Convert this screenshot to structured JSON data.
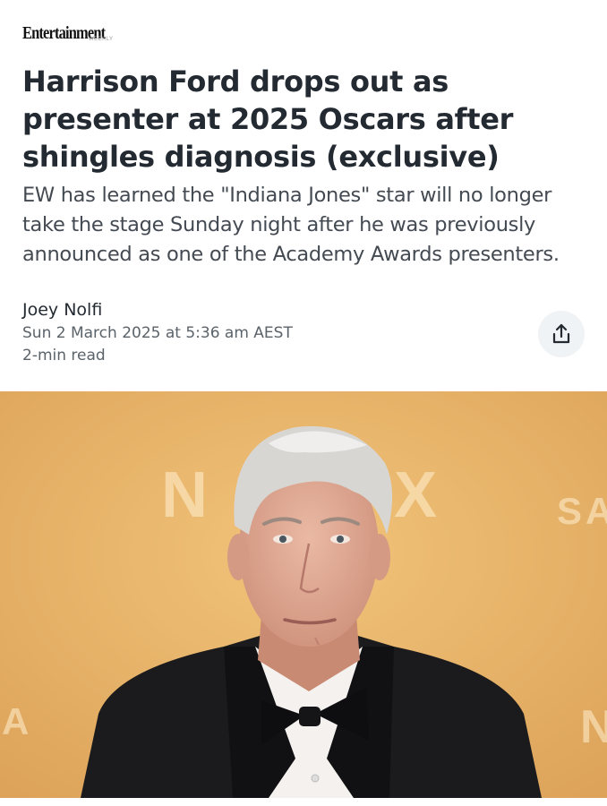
{
  "publication": {
    "name": "Entertainment",
    "sub": "WEEKLY"
  },
  "article": {
    "headline": "Harrison Ford drops out as presenter at 2025 Oscars after shingles diagnosis (exclusive)",
    "dek": "EW has learned the \"Indiana Jones\" star will no longer take the stage Sunday night after he was previously announced as one of the Academy Awards presenters.",
    "author": "Joey Nolfi",
    "date": "Sun 2 March 2025 at 5:36 am AEST",
    "read_time": "2-min read"
  },
  "share": {
    "icon": "share-icon"
  },
  "photo": {
    "backdrop_text_left": "N",
    "backdrop_text_mid": "X",
    "backdrop_text_right": "SA",
    "backdrop_text_bottom_left": "A",
    "backdrop_text_bottom_right": "N",
    "background_color": "#e9b563"
  }
}
